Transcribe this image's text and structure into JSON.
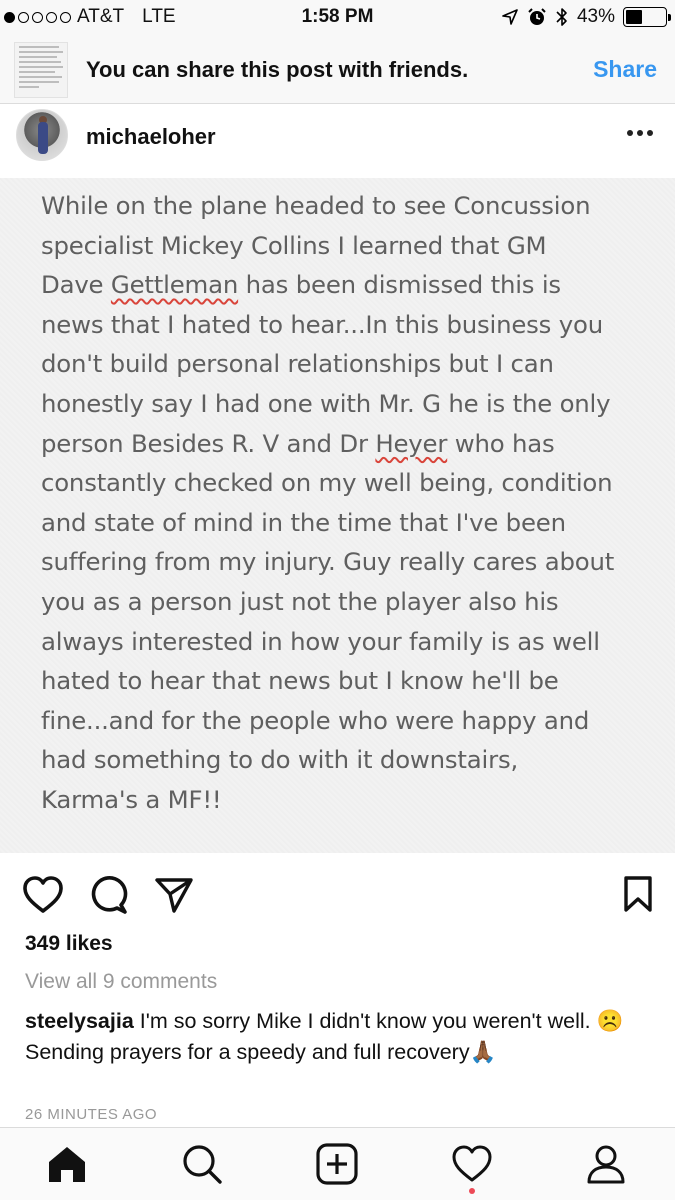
{
  "status_bar": {
    "signal_bars_filled": 1,
    "signal_bars_total": 5,
    "carrier": "AT&T",
    "network": "LTE",
    "time": "1:58 PM",
    "battery_percent_label": "43%",
    "battery_level": 0.43,
    "icons": [
      "location-arrow-icon",
      "alarm-icon",
      "bluetooth-icon",
      "battery-icon"
    ]
  },
  "share_banner": {
    "message": "You can share this post with friends.",
    "action_label": "Share"
  },
  "post": {
    "username": "michaeloher",
    "text_lines": [
      "While on the plane headed to see Concussion",
      "specialist Mickey Collins I learned that GM",
      "Dave Gettleman has been dismissed this is",
      "news that I hated to hear...In this business you",
      "don't build personal relationships but I can",
      "honestly say I had one with Mr. G he is the only",
      "person Besides R. V and Dr Heyer who has",
      "constantly checked on my well being, condition",
      "and state of mind in the time that I've been",
      "suffering from my injury. Guy really cares about",
      "you as a person just not the player also his",
      "always interested in how your family is as well",
      "hated to hear that news but I know he'll be",
      "fine...and for the people who were happy and",
      "had something to do with it downstairs,",
      "Karma's a MF!!"
    ],
    "likes": "349 likes",
    "view_comments": "View all 9 comments",
    "comment": {
      "author": "steelysajia",
      "text": "I'm so sorry Mike I didn't know you weren't well. ☹️ Sending prayers for a speedy and full recovery🙏🏾"
    },
    "timestamp": "26 MINUTES AGO"
  },
  "tabbar": {
    "items": [
      "home-icon",
      "search-icon",
      "new-post-icon",
      "activity-heart-icon",
      "profile-icon"
    ],
    "active": "home-icon"
  },
  "colors": {
    "link_blue": "#3897f0",
    "note_text": "#5f5f5f",
    "spellcheck_red": "#d9453b",
    "notification_red": "#ed4956"
  }
}
